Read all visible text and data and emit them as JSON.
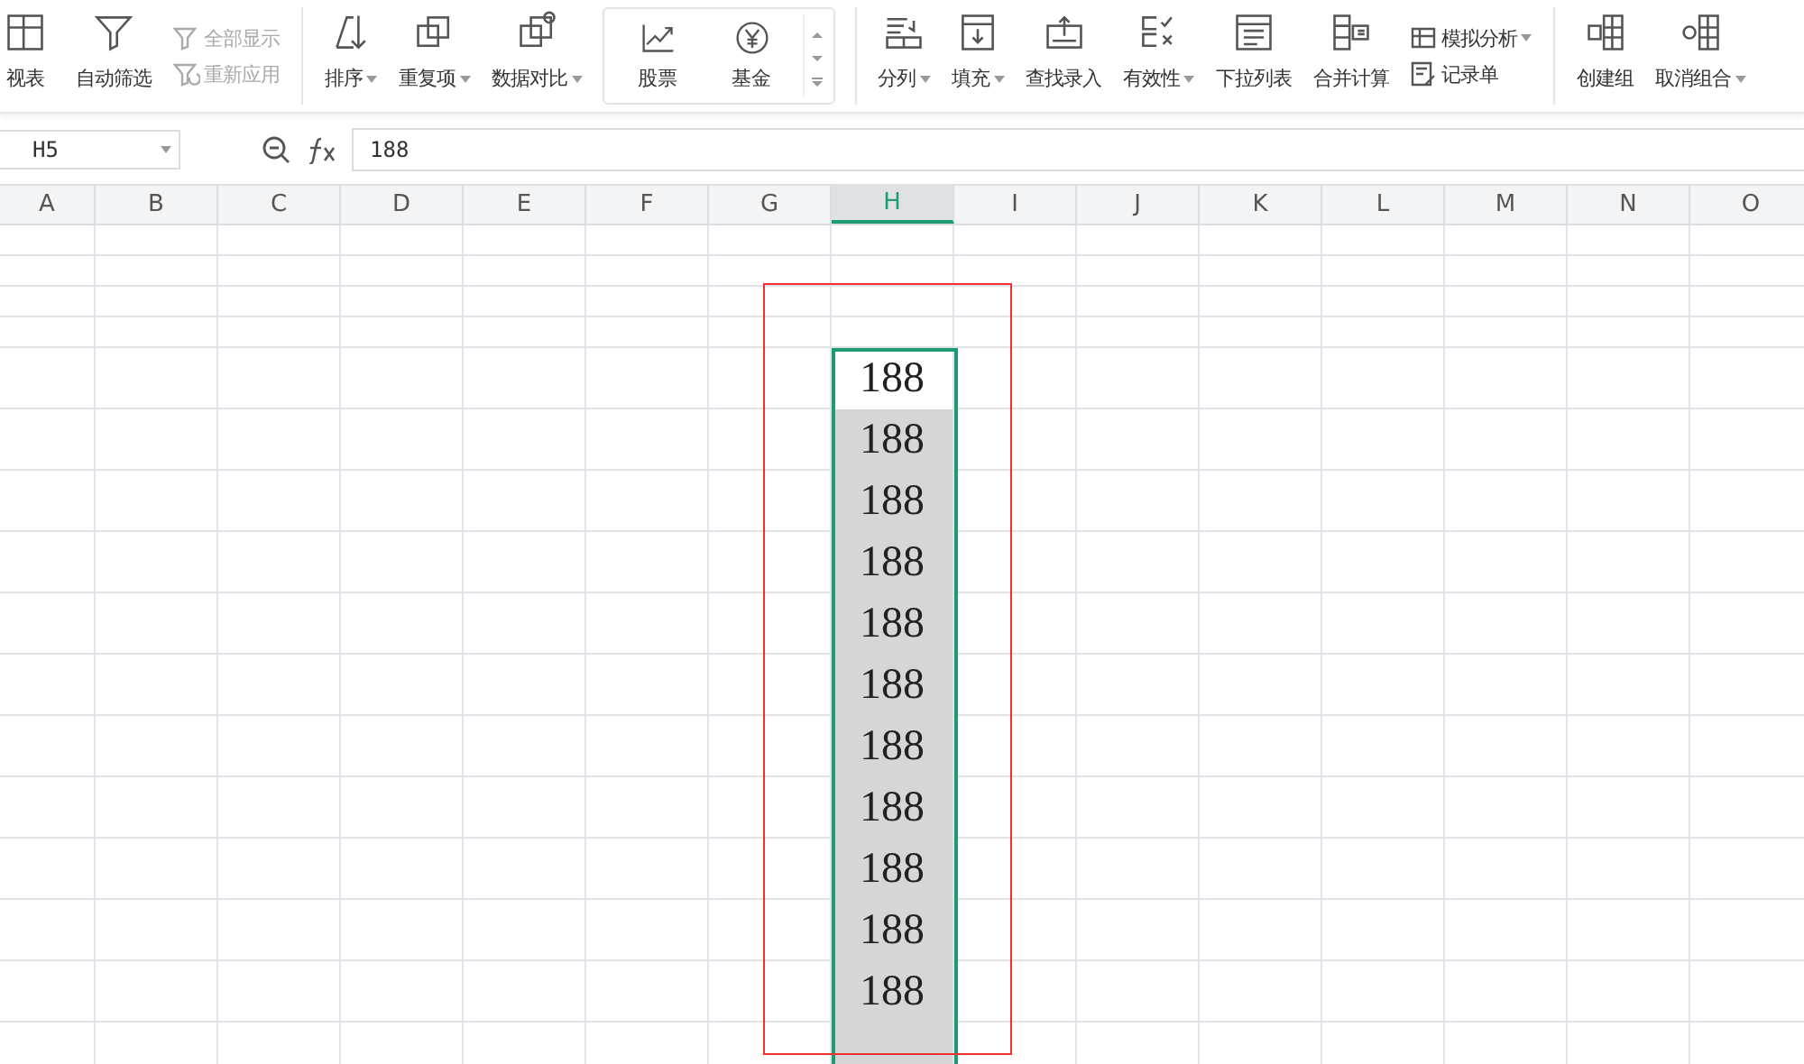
{
  "toolbar": {
    "items": [
      {
        "kind": "large",
        "label": "视表",
        "dropdown": false
      },
      {
        "kind": "large",
        "label": "自动筛选",
        "dropdown": false
      },
      {
        "kind": "stack",
        "entries": [
          {
            "label": "全部显示",
            "disabled": true
          },
          {
            "label": "重新应用",
            "disabled": true
          }
        ]
      },
      {
        "kind": "divider"
      },
      {
        "kind": "large",
        "label": "排序",
        "dropdown": true
      },
      {
        "kind": "large",
        "label": "重复项",
        "dropdown": true
      },
      {
        "kind": "large",
        "label": "数据对比",
        "dropdown": true
      },
      {
        "kind": "gallery",
        "entries": [
          {
            "label": "股票"
          },
          {
            "label": "基金"
          }
        ]
      },
      {
        "kind": "divider"
      },
      {
        "kind": "large",
        "label": "分列",
        "dropdown": true
      },
      {
        "kind": "large",
        "label": "填充",
        "dropdown": true
      },
      {
        "kind": "large",
        "label": "查找录入",
        "dropdown": false
      },
      {
        "kind": "large",
        "label": "有效性",
        "dropdown": true
      },
      {
        "kind": "large",
        "label": "下拉列表",
        "dropdown": false
      },
      {
        "kind": "large",
        "label": "合并计算",
        "dropdown": false
      },
      {
        "kind": "stack",
        "entries": [
          {
            "label": "模拟分析",
            "disabled": false,
            "dropdown": true
          },
          {
            "label": "记录单",
            "disabled": false,
            "dropdown": false
          }
        ]
      },
      {
        "kind": "divider"
      },
      {
        "kind": "large",
        "label": "创建组",
        "dropdown": false
      },
      {
        "kind": "large",
        "label": "取消组合",
        "dropdown": true
      }
    ]
  },
  "formula_bar": {
    "name_box": "H5",
    "formula": "188"
  },
  "sheet": {
    "columns": [
      {
        "label": "A",
        "selected": false
      },
      {
        "label": "B",
        "selected": false
      },
      {
        "label": "C",
        "selected": false
      },
      {
        "label": "D",
        "selected": false
      },
      {
        "label": "E",
        "selected": false
      },
      {
        "label": "F",
        "selected": false
      },
      {
        "label": "G",
        "selected": false
      },
      {
        "label": "H",
        "selected": true
      },
      {
        "label": "I",
        "selected": false
      },
      {
        "label": "J",
        "selected": false
      },
      {
        "label": "K",
        "selected": false
      },
      {
        "label": "L",
        "selected": false
      },
      {
        "label": "M",
        "selected": false
      },
      {
        "label": "N",
        "selected": false
      },
      {
        "label": "O",
        "selected": false
      }
    ],
    "h_cells": [
      {
        "value": "188",
        "active": true
      },
      {
        "value": "188",
        "active": false
      },
      {
        "value": "188",
        "active": false
      },
      {
        "value": "188",
        "active": false
      },
      {
        "value": "188",
        "active": false
      },
      {
        "value": "188",
        "active": false
      },
      {
        "value": "188",
        "active": false
      },
      {
        "value": "188",
        "active": false
      },
      {
        "value": "188",
        "active": false
      },
      {
        "value": "188",
        "active": false
      },
      {
        "value": "188",
        "active": false
      },
      {
        "active": false
      }
    ]
  }
}
